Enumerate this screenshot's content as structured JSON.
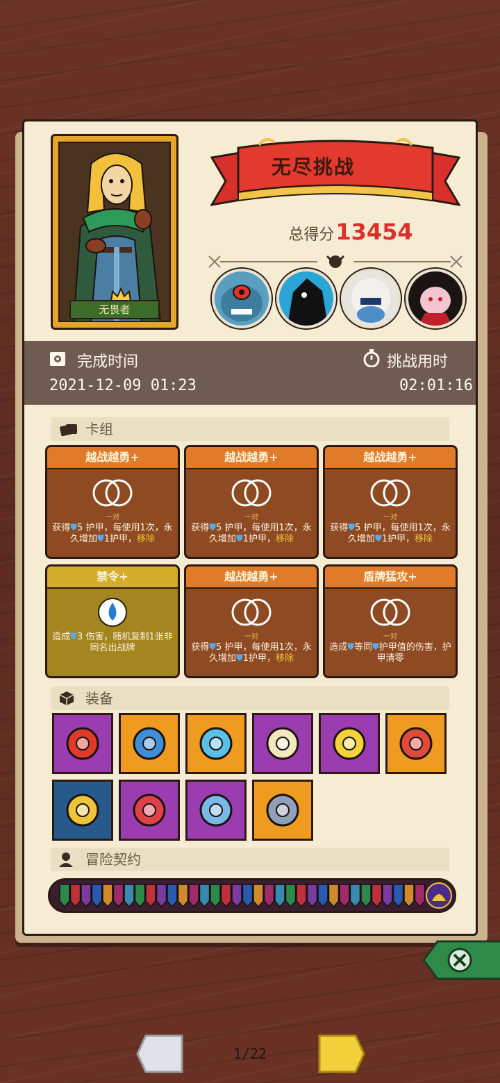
{
  "challenge": {
    "title": "无尽挑战",
    "score_label": "总得分",
    "score": "13454"
  },
  "hero": {
    "name": "无畏者"
  },
  "stats": {
    "finish_time_label": "完成时间",
    "finish_time_value": "2021-12-09 01:23",
    "duration_label": "挑战用时",
    "duration_value": "02:01:16"
  },
  "sections": {
    "deck": "卡组",
    "equipment": "装备",
    "contract": "冒险契约"
  },
  "cards": [
    {
      "title": "越战越勇+",
      "style": "brown",
      "art": "rings",
      "cost": "一对",
      "desc_a": "获得",
      "desc_b": "5 护甲，每使用1次，永久增加",
      "desc_c": "1护甲，",
      "desc_kw": "移除"
    },
    {
      "title": "越战越勇+",
      "style": "brown",
      "art": "rings",
      "cost": "一对",
      "desc_a": "获得",
      "desc_b": "5 护甲，每使用1次，永久增加",
      "desc_c": "1护甲，",
      "desc_kw": "移除"
    },
    {
      "title": "越战越勇+",
      "style": "brown",
      "art": "rings",
      "cost": "一对",
      "desc_a": "获得",
      "desc_b": "5 护甲，每使用1次，永久增加",
      "desc_c": "1护甲，",
      "desc_kw": "移除"
    },
    {
      "title": "禁令+",
      "style": "olive",
      "art": "drop",
      "cost": "",
      "desc_a": "造成",
      "desc_b": "3 伤害，随机复制1张非同名出战牌",
      "desc_c": "",
      "desc_kw": ""
    },
    {
      "title": "越战越勇+",
      "style": "brown",
      "art": "rings",
      "cost": "一对",
      "desc_a": "获得",
      "desc_b": "5 护甲，每使用1次，永久增加",
      "desc_c": "1护甲，",
      "desc_kw": "移除"
    },
    {
      "title": "盾牌猛攻+",
      "style": "brown",
      "art": "rings",
      "cost": "一对",
      "desc_a": "造成",
      "desc_b": "等同",
      "desc_c": "护甲值的伤害，护甲清零",
      "desc_kw": ""
    }
  ],
  "equipment_icons": [
    {
      "name": "red-gauntlet-icon",
      "bg": "purple"
    },
    {
      "name": "blue-mushroom-icon",
      "bg": "orange"
    },
    {
      "name": "jack-o-lantern-gem-icon",
      "bg": "orange"
    },
    {
      "name": "mirror-icon",
      "bg": "purple"
    },
    {
      "name": "moon-star-icon",
      "bg": "purple"
    },
    {
      "name": "red-shield-disc-icon",
      "bg": "orange"
    },
    {
      "name": "compass-armor-icon",
      "bg": "blue"
    },
    {
      "name": "bloody-cloth-icon",
      "bg": "purple"
    },
    {
      "name": "diamond-ring-icon",
      "bg": "purple"
    },
    {
      "name": "horn-icon",
      "bg": "orange"
    }
  ],
  "pagination": {
    "page": "1/22"
  },
  "colors": {
    "accent_red": "#d9302a",
    "page_bg": "#f6ecd3",
    "stats_bg": "#6f5b51",
    "card_brown": "#8e4a22",
    "card_olive": "#a48621"
  }
}
